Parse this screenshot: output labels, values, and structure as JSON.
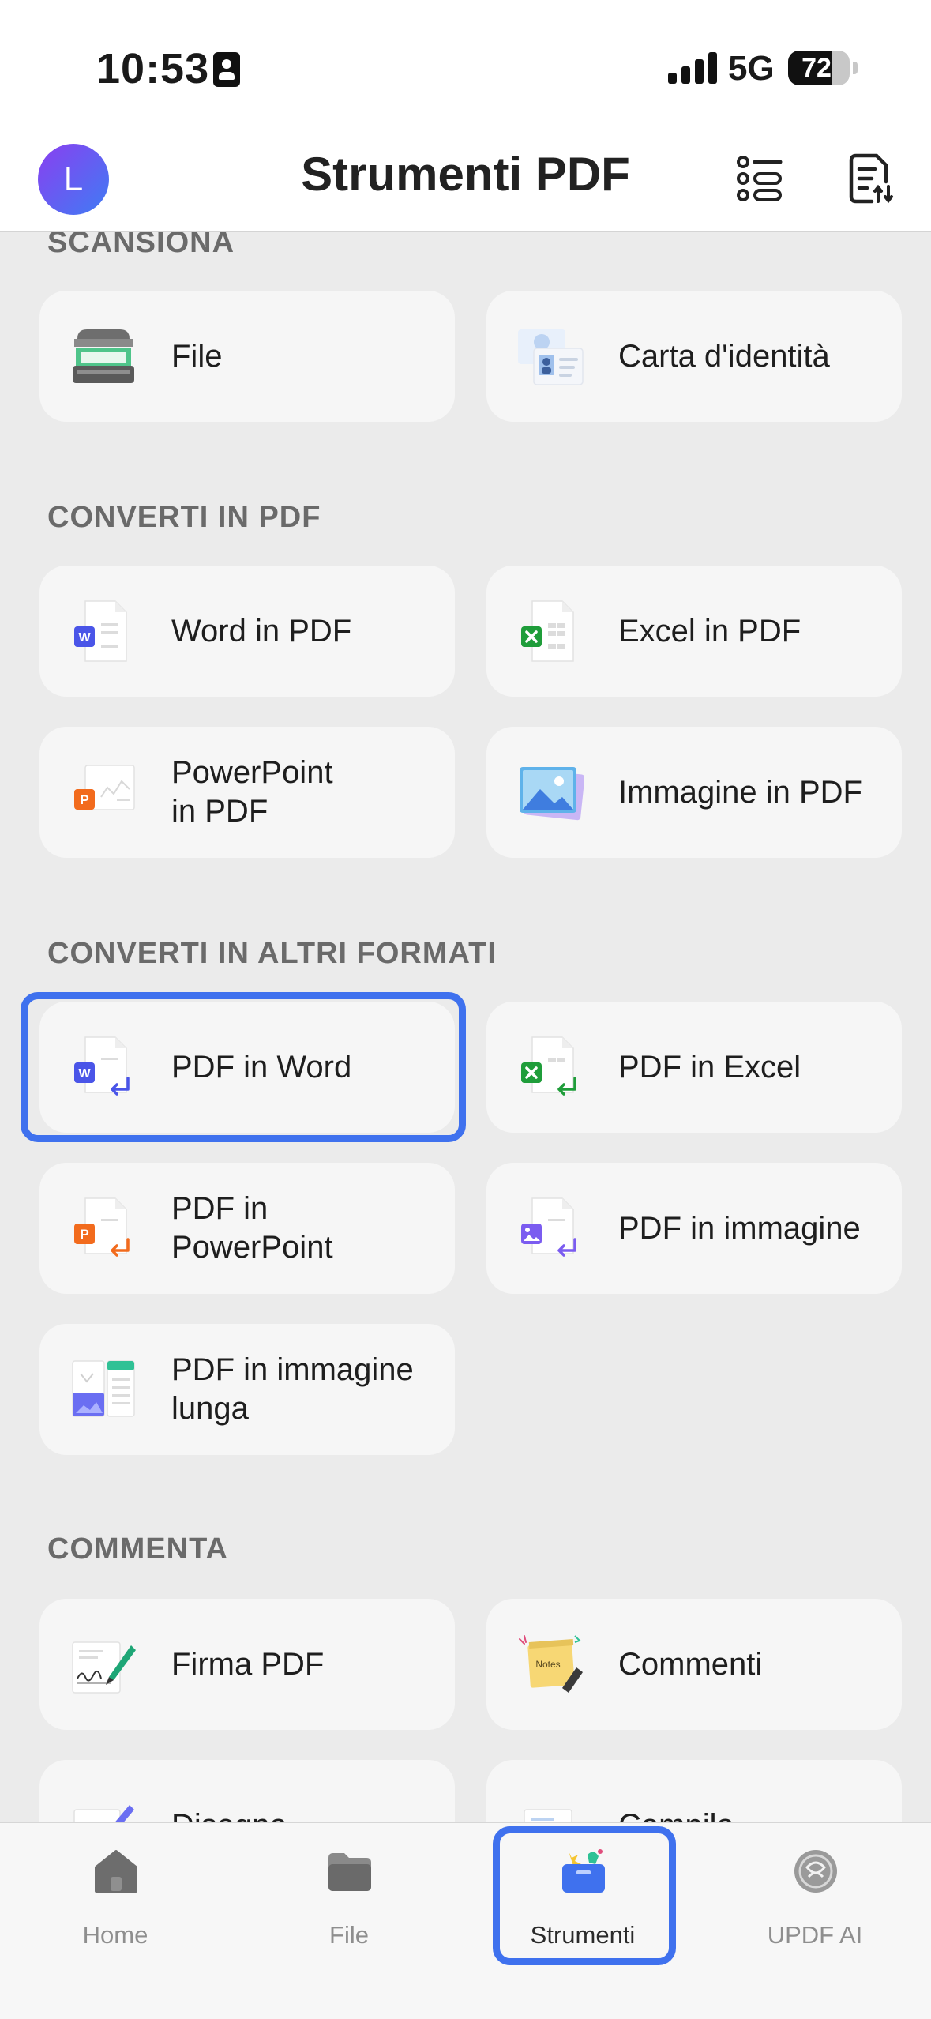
{
  "status_bar": {
    "time": "10:53",
    "network": "5G",
    "battery": "72",
    "battery_level_percent": 72
  },
  "header": {
    "avatar_letter": "L",
    "title": "Strumenti PDF"
  },
  "sections": {
    "scan": {
      "title": "SCANSIONA",
      "items": [
        "File",
        "Carta d'identità"
      ]
    },
    "to_pdf": {
      "title": "CONVERTI IN PDF",
      "items": [
        "Word in PDF",
        "Excel in PDF",
        "PowerPoint\nin PDF",
        "Immagine in PDF"
      ]
    },
    "other_formats": {
      "title": "CONVERTI IN ALTRI FORMATI",
      "items": [
        "PDF in Word",
        "PDF in Excel",
        "PDF in\nPowerPoint",
        "PDF in immagine",
        "PDF in immagine\nlunga"
      ]
    },
    "comment": {
      "title": "COMMENTA",
      "items": [
        "Firma PDF",
        "Commenti",
        "Disegna",
        "Compila"
      ]
    }
  },
  "tabbar": {
    "items": [
      "Home",
      "File",
      "Strumenti",
      "UPDF AI"
    ],
    "active": "Strumenti"
  },
  "colors": {
    "accent_highlight": "#3f71ee",
    "word": "#4a55e8",
    "excel": "#1f9d3a",
    "powerpoint": "#f26b1d",
    "image": "#7b5cf0"
  },
  "icons": [
    "scanner-icon",
    "id-card-icon",
    "word-doc-icon",
    "excel-doc-icon",
    "powerpoint-doc-icon",
    "image-icon",
    "long-image-icon",
    "signature-icon",
    "notes-icon",
    "draw-icon",
    "form-icon",
    "list-icon",
    "document-sort-icon",
    "home-icon",
    "folder-icon",
    "toolbox-icon",
    "ai-icon"
  ]
}
